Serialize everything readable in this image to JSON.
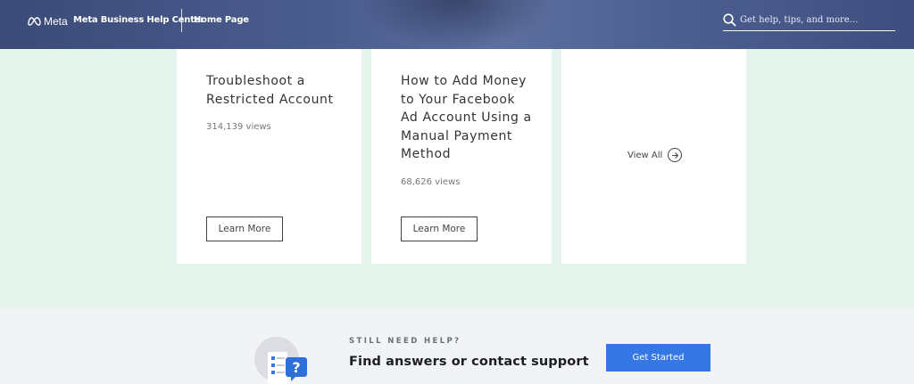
{
  "header": {
    "logo_text": "Meta",
    "brand": "Meta Business Help Center",
    "home_link": "Home Page",
    "search_placeholder": "Get help, tips, and more..."
  },
  "cards": [
    {
      "title": "Troubleshoot a Restricted Account",
      "views": "314,139 views",
      "button": "Learn More"
    },
    {
      "title": "How to Add Money to Your Facebook Ad Account Using a Manual Payment Method",
      "views": "68,626 views",
      "button": "Learn More"
    }
  ],
  "view_all": {
    "label": "View All"
  },
  "help": {
    "eyebrow": "STILL NEED HELP?",
    "title": "Find answers or contact support",
    "button": "Get Started"
  },
  "colors": {
    "header": "#4a5c8e",
    "band": "#e5f5ee",
    "button_primary": "#3578e5"
  }
}
